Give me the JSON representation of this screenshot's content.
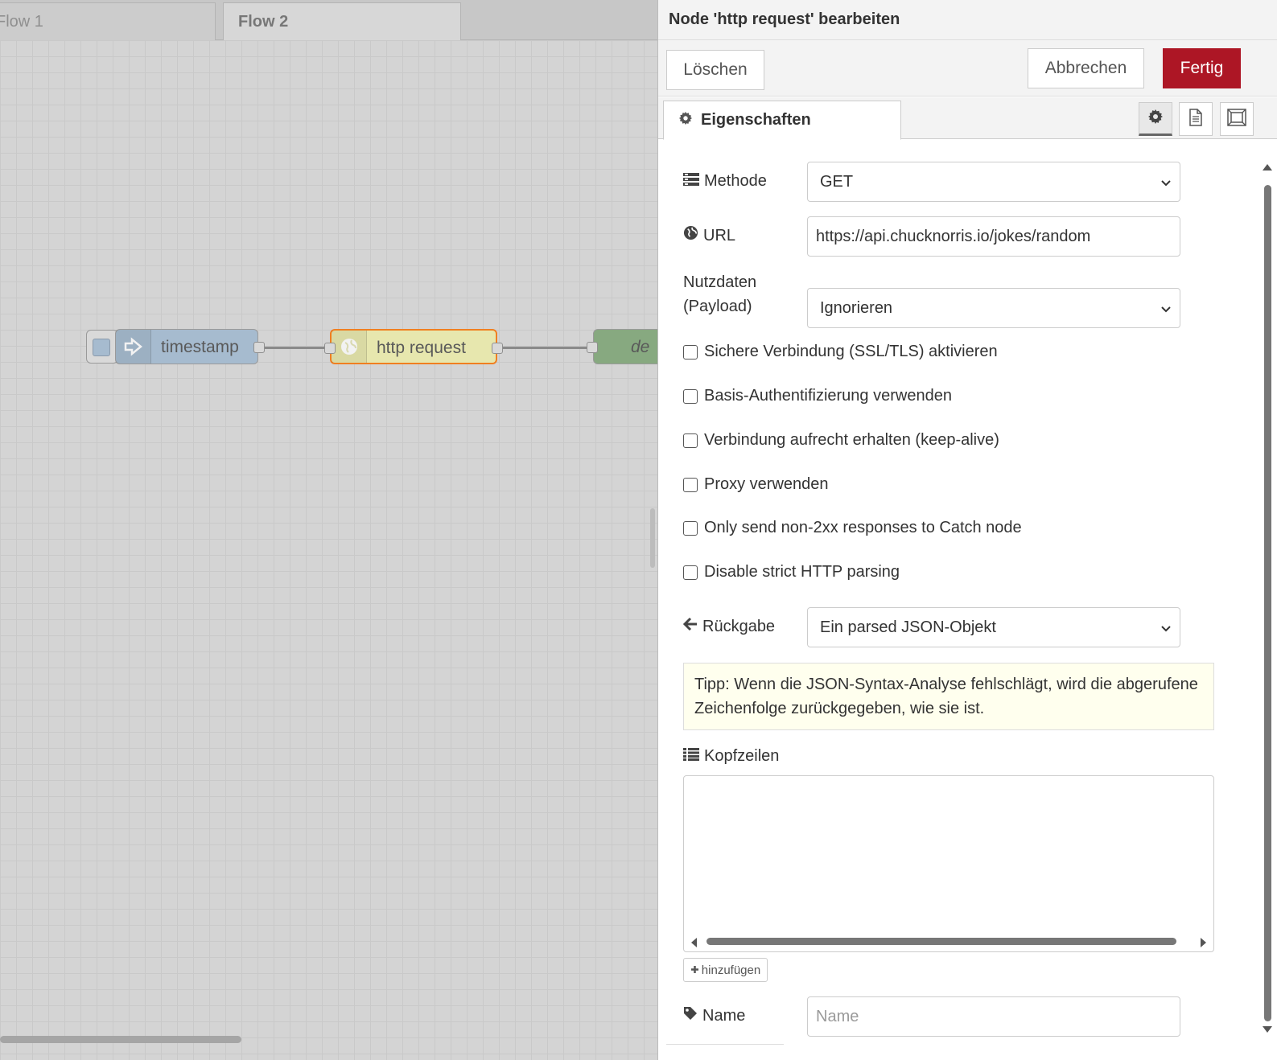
{
  "workspace": {
    "tabs": [
      {
        "label": "Flow 1"
      },
      {
        "label": "Flow 2"
      }
    ],
    "nodes": {
      "inject": {
        "label": "timestamp",
        "color": "#a6bbcf"
      },
      "http": {
        "label": "http request",
        "color": "#e7e7ae",
        "selected_border": "#f07f21"
      },
      "debug": {
        "label": "de",
        "color": "#87a980"
      }
    }
  },
  "tray": {
    "title": "Node 'http request' bearbeiten",
    "toolbar": {
      "delete_label": "Löschen",
      "cancel_label": "Abbrechen",
      "done_label": "Fertig"
    },
    "tabs": {
      "properties_label": "Eigenschaften"
    },
    "form": {
      "method": {
        "label": "Methode",
        "value": "GET"
      },
      "url": {
        "label": "URL",
        "value": "https://api.chucknorris.io/jokes/random"
      },
      "payload": {
        "label_line1": "Nutzdaten",
        "label_line2": "(Payload)",
        "value": "Ignorieren"
      },
      "checkboxes": [
        {
          "label": "Sichere Verbindung (SSL/TLS) aktivieren",
          "checked": false
        },
        {
          "label": "Basis-Authentifizierung verwenden",
          "checked": false
        },
        {
          "label": "Verbindung aufrecht erhalten (keep-alive)",
          "checked": false
        },
        {
          "label": "Proxy verwenden",
          "checked": false
        },
        {
          "label": "Only send non-2xx responses to Catch node",
          "checked": false
        },
        {
          "label": "Disable strict HTTP parsing",
          "checked": false
        }
      ],
      "return": {
        "label": "Rückgabe",
        "value": "Ein parsed JSON-Objekt"
      },
      "tip": "Tipp: Wenn die JSON-Syntax-Analyse fehlschlägt, wird die abgerufene Zeichenfolge zurückgegeben, wie sie ist.",
      "headers": {
        "label": "Kopfzeilen",
        "add_label": "hinzufügen"
      },
      "name": {
        "label": "Name",
        "placeholder": "Name"
      }
    }
  },
  "colors": {
    "primary_button": "#ad1625",
    "tip_background": "#ffffee"
  }
}
